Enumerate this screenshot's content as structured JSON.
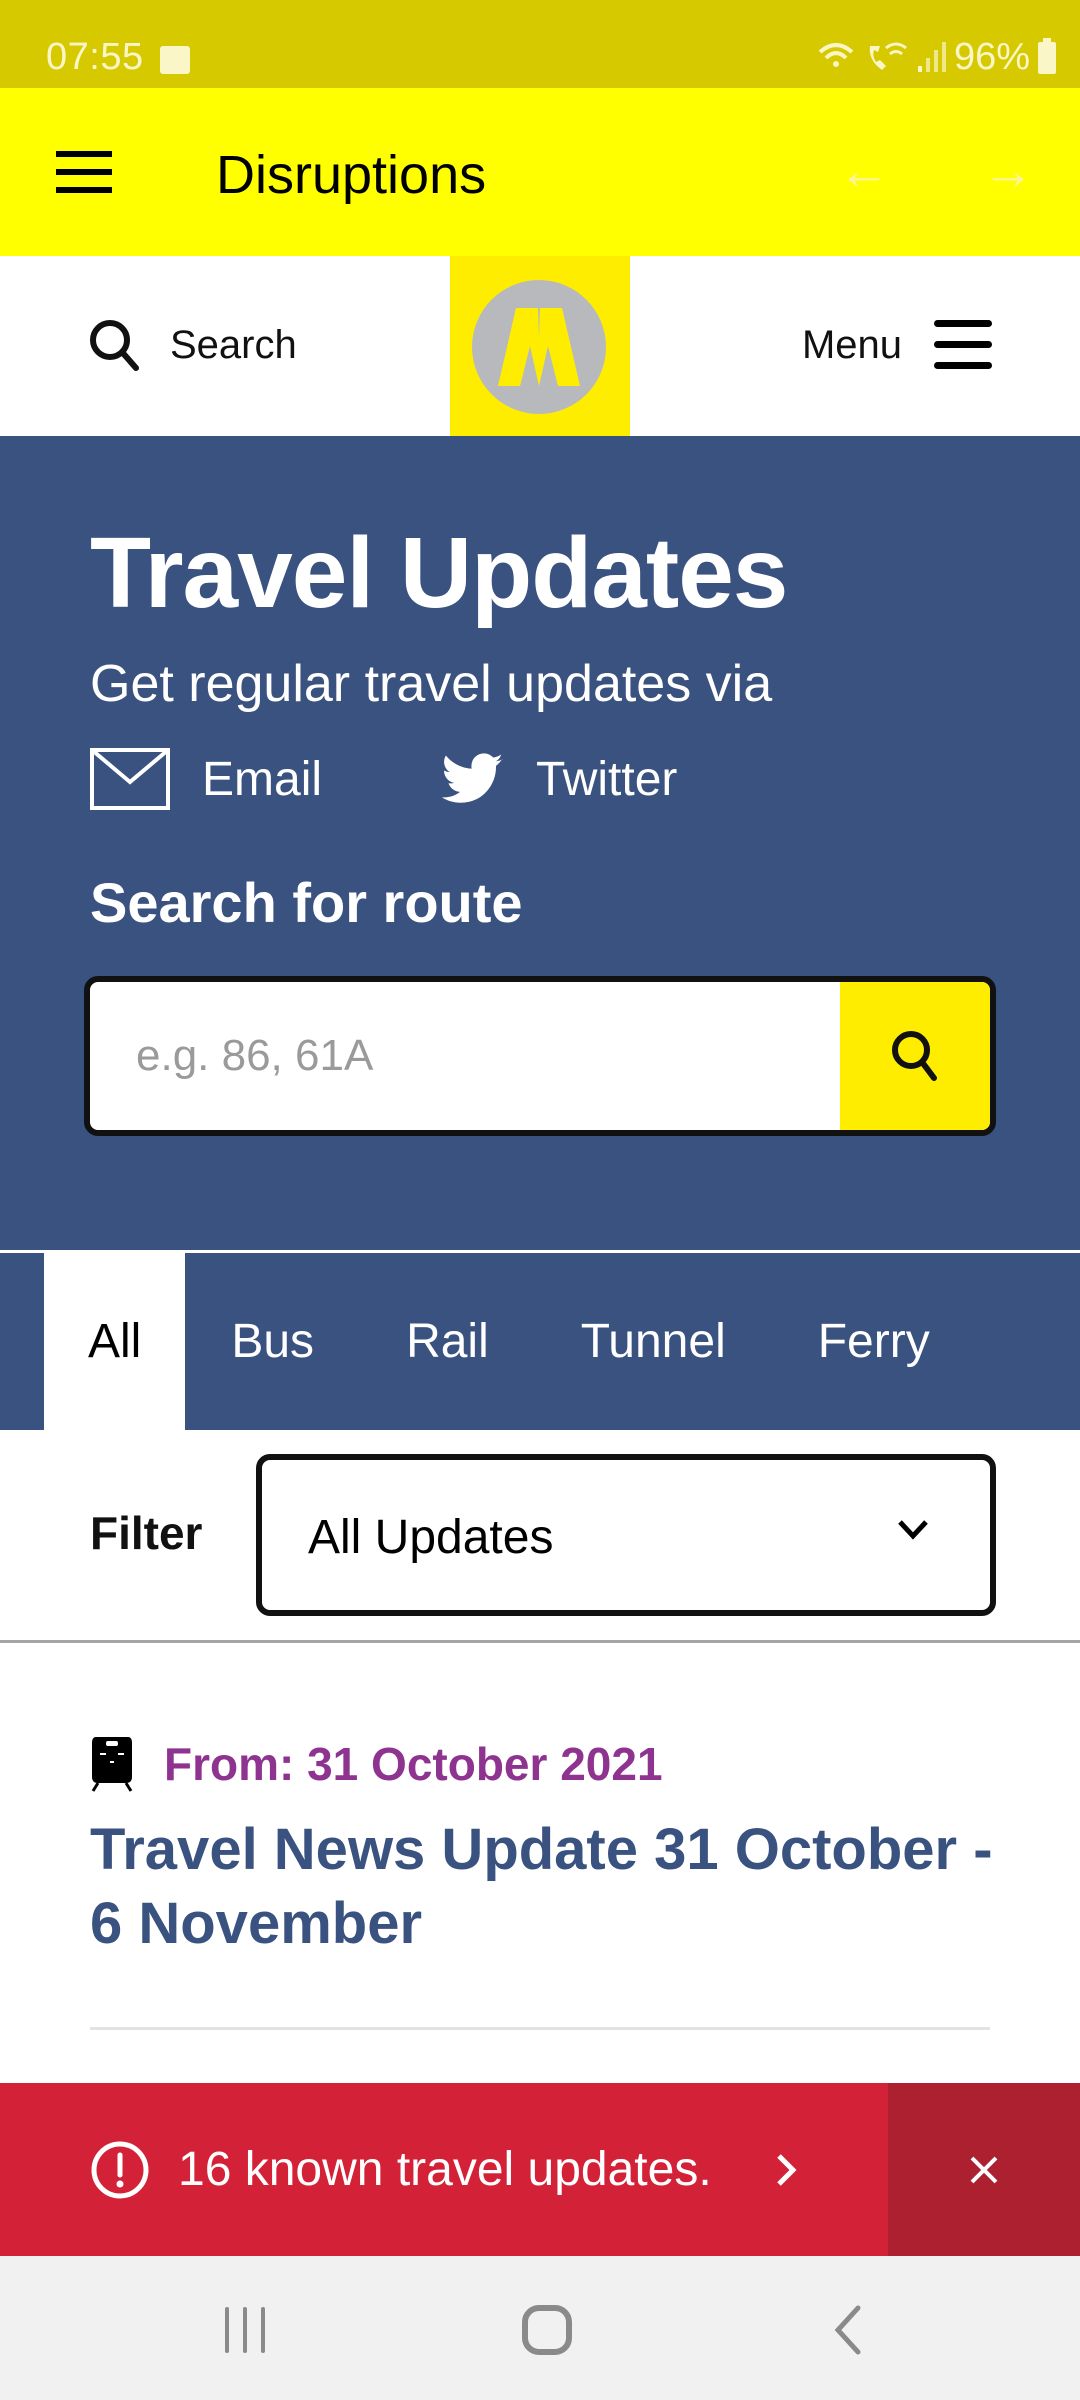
{
  "status_bar": {
    "time": "07:55",
    "battery": "96%",
    "icons": [
      "gallery-icon",
      "wifi-icon",
      "wifi-calling-icon",
      "signal-icon",
      "battery-icon"
    ]
  },
  "app_bar": {
    "title": "Disruptions",
    "back_arrow": "←",
    "forward_arrow": "→"
  },
  "site_header": {
    "search_label": "Search",
    "menu_label": "Menu",
    "logo_letter": "M"
  },
  "hero": {
    "title": "Travel Updates",
    "subtitle": "Get regular travel updates via",
    "share_options": [
      {
        "label": "Email",
        "icon": "email-icon"
      },
      {
        "label": "Twitter",
        "icon": "twitter-icon"
      }
    ],
    "route_search": {
      "label": "Search for route",
      "placeholder": "e.g. 86, 61A",
      "value": ""
    }
  },
  "tabs": [
    {
      "label": "All",
      "active": true
    },
    {
      "label": "Bus",
      "active": false
    },
    {
      "label": "Rail",
      "active": false
    },
    {
      "label": "Tunnel",
      "active": false
    },
    {
      "label": "Ferry",
      "active": false
    }
  ],
  "filter": {
    "label": "Filter",
    "selected": "All Updates"
  },
  "updates": [
    {
      "icon": "train-icon",
      "date": "From: 31 October 2021",
      "title": "Travel News Update 31 October - 6 November"
    }
  ],
  "alert": {
    "text": "16 known travel updates.",
    "count": 16
  },
  "colors": {
    "status_bar": "#d6c900",
    "app_bar": "#ffff00",
    "brand_yellow": "#ffed00",
    "hero_blue": "#3a5280",
    "date_purple": "#8e3390",
    "alert_red": "#d32237",
    "alert_close_red": "#ac2030"
  }
}
